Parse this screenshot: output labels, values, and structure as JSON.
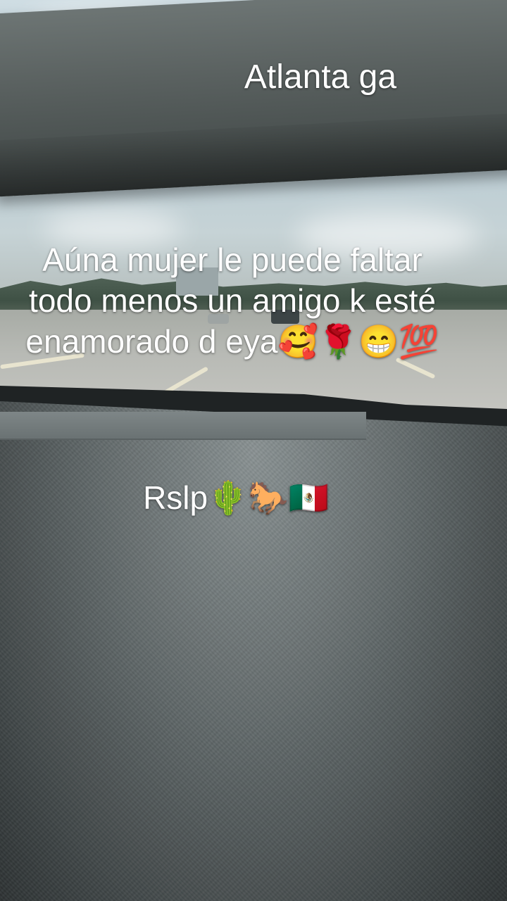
{
  "overlay": {
    "location": "Atlanta ga",
    "message": "Aúna mujer le puede faltar todo menos un amigo k esté enamorado d eya🥰🌹😁💯",
    "signature": "Rslp🌵🐎🇲🇽"
  }
}
